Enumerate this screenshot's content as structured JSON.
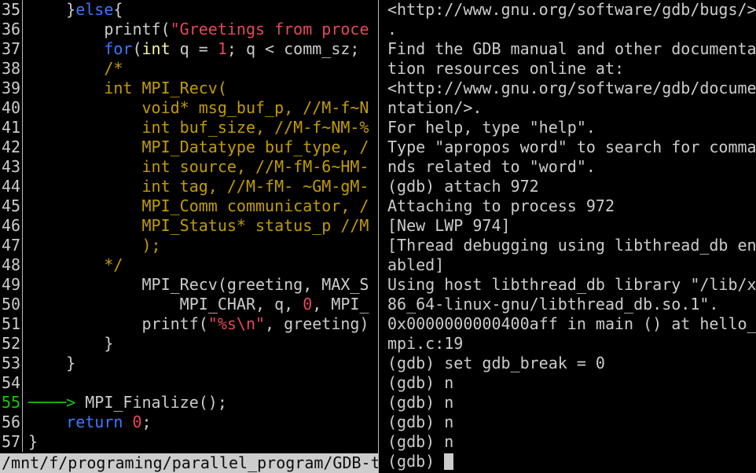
{
  "source": {
    "lines": [
      {
        "no": "35",
        "current": false,
        "tokens": [
          [
            "fn",
            "    }"
          ],
          [
            "kw",
            "else"
          ],
          [
            "fn",
            "{"
          ]
        ]
      },
      {
        "no": "36",
        "current": false,
        "tokens": [
          [
            "fn",
            "        printf("
          ],
          [
            "str",
            "\"Greetings from proce"
          ]
        ]
      },
      {
        "no": "37",
        "current": false,
        "tokens": [
          [
            "fn",
            "        "
          ],
          [
            "kw",
            "for"
          ],
          [
            "fn",
            "("
          ],
          [
            "ty",
            "int"
          ],
          [
            "fn",
            " q = "
          ],
          [
            "num",
            "1"
          ],
          [
            "fn",
            "; q < comm_sz;"
          ]
        ]
      },
      {
        "no": "38",
        "current": false,
        "tokens": [
          [
            "cm",
            "        /*"
          ]
        ]
      },
      {
        "no": "39",
        "current": false,
        "tokens": [
          [
            "cm",
            "        int MPI_Recv("
          ]
        ]
      },
      {
        "no": "40",
        "current": false,
        "tokens": [
          [
            "cm",
            "            void* msg_buf_p, //M-f~N"
          ]
        ]
      },
      {
        "no": "41",
        "current": false,
        "tokens": [
          [
            "cm",
            "            int buf_size, //M-f~NM-%"
          ]
        ]
      },
      {
        "no": "42",
        "current": false,
        "tokens": [
          [
            "cm",
            "            MPI_Datatype buf_type, /"
          ]
        ]
      },
      {
        "no": "43",
        "current": false,
        "tokens": [
          [
            "cm",
            "            int source, //M-fM-6~HM-"
          ]
        ]
      },
      {
        "no": "44",
        "current": false,
        "tokens": [
          [
            "cm",
            "            int tag, //M-fM- ~GM-gM-"
          ]
        ]
      },
      {
        "no": "45",
        "current": false,
        "tokens": [
          [
            "cm",
            "            MPI_Comm communicator, /"
          ]
        ]
      },
      {
        "no": "46",
        "current": false,
        "tokens": [
          [
            "cm",
            "            MPI_Status* status_p //M"
          ]
        ]
      },
      {
        "no": "47",
        "current": false,
        "tokens": [
          [
            "cm",
            "            );"
          ]
        ]
      },
      {
        "no": "48",
        "current": false,
        "tokens": [
          [
            "cm",
            "        */"
          ]
        ]
      },
      {
        "no": "49",
        "current": false,
        "tokens": [
          [
            "fn",
            "            MPI_Recv(greeting, MAX_S"
          ]
        ]
      },
      {
        "no": "50",
        "current": false,
        "tokens": [
          [
            "fn",
            "                MPI_CHAR, q, "
          ],
          [
            "num",
            "0"
          ],
          [
            "fn",
            ", MPI_"
          ]
        ]
      },
      {
        "no": "51",
        "current": false,
        "tokens": [
          [
            "fn",
            "            printf("
          ],
          [
            "str",
            "\"%s\\n\""
          ],
          [
            "fn",
            ", greeting)"
          ]
        ]
      },
      {
        "no": "52",
        "current": false,
        "tokens": [
          [
            "fn",
            "        }"
          ]
        ]
      },
      {
        "no": "53",
        "current": false,
        "tokens": [
          [
            "fn",
            "    }"
          ]
        ]
      },
      {
        "no": "54",
        "current": false,
        "tokens": []
      },
      {
        "no": "55",
        "current": true,
        "tokens": [
          [
            "arrow",
            "────> "
          ],
          [
            "fn",
            "MPI_Finalize();"
          ]
        ]
      },
      {
        "no": "56",
        "current": false,
        "tokens": [
          [
            "fn",
            "    "
          ],
          [
            "kw",
            "return"
          ],
          [
            "fn",
            " "
          ],
          [
            "num",
            "0"
          ],
          [
            "fn",
            ";"
          ]
        ]
      },
      {
        "no": "57",
        "current": false,
        "tokens": [
          [
            "fn",
            "}"
          ]
        ]
      }
    ]
  },
  "status_bar": {
    "path": "/mnt/f/programing/parallel_program/GDB-t"
  },
  "terminal": {
    "lines": [
      "<http://www.gnu.org/software/gdb/bugs/>",
      ".",
      "Find the GDB manual and other documenta",
      "tion resources online at:",
      "<http://www.gnu.org/software/gdb/docume",
      "ntation/>.",
      "For help, type \"help\".",
      "Type \"apropos word\" to search for comma",
      "nds related to \"word\".",
      "(gdb) attach 972",
      "Attaching to process 972",
      "[New LWP 974]",
      "[Thread debugging using libthread_db en",
      "abled]",
      "Using host libthread_db library \"/lib/x",
      "86_64-linux-gnu/libthread_db.so.1\".",
      "0x0000000000400aff in main () at hello_",
      "mpi.c:19",
      "(gdb) set gdb_break = 0",
      "(gdb) n",
      "(gdb) n",
      "(gdb) n",
      "(gdb) n"
    ],
    "prompt": "(gdb) "
  },
  "colors": {
    "background": "#000000",
    "foreground": "#cccccc",
    "keyword": "#3b78ff",
    "type": "#f9f1a5",
    "comment": "#c19c00",
    "string": "#e74856",
    "current_line": "#16c60c"
  }
}
